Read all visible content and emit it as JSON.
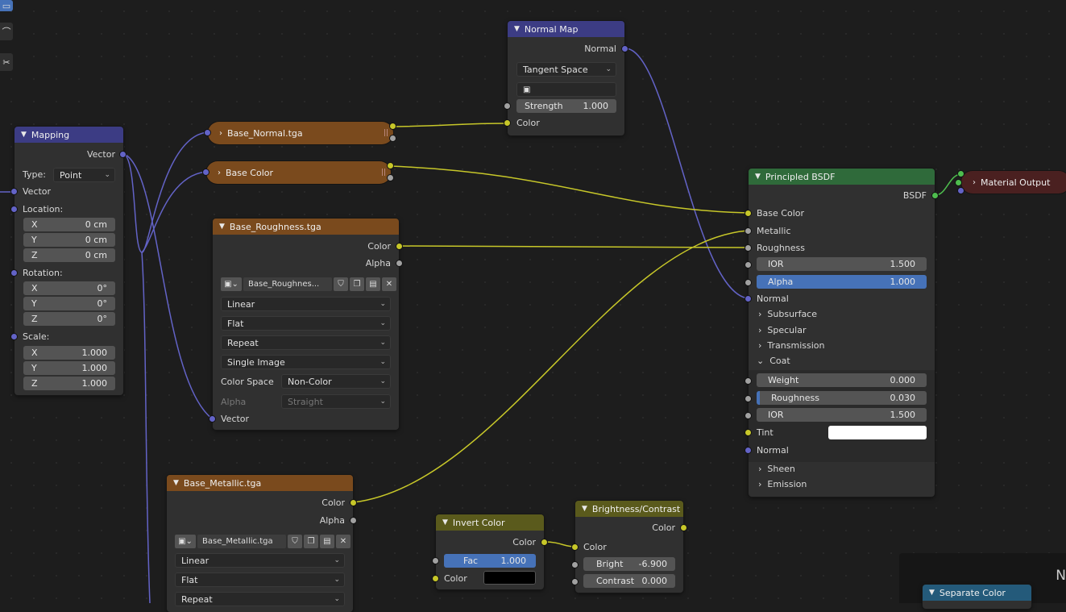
{
  "mapping": {
    "title": "Mapping",
    "out_vector": "Vector",
    "type_label": "Type:",
    "type_value": "Point",
    "in_vector": "Vector",
    "location": "Location:",
    "rotation": "Rotation:",
    "scale": "Scale:",
    "loc": [
      {
        "axis": "X",
        "value": "0 cm"
      },
      {
        "axis": "Y",
        "value": "0 cm"
      },
      {
        "axis": "Z",
        "value": "0 cm"
      }
    ],
    "rot": [
      {
        "axis": "X",
        "value": "0°"
      },
      {
        "axis": "Y",
        "value": "0°"
      },
      {
        "axis": "Z",
        "value": "0°"
      }
    ],
    "scl": [
      {
        "axis": "X",
        "value": "1.000"
      },
      {
        "axis": "Y",
        "value": "1.000"
      },
      {
        "axis": "Z",
        "value": "1.000"
      }
    ]
  },
  "base_normal": {
    "title": "Base_Normal.tga"
  },
  "base_color": {
    "title": "Base Color"
  },
  "normal_map": {
    "title": "Normal Map",
    "out_normal": "Normal",
    "space": "Tangent Space",
    "strength_label": "Strength",
    "strength_value": "1.000",
    "in_color": "Color"
  },
  "roughness": {
    "title": "Base_Roughness.tga",
    "out_color": "Color",
    "out_alpha": "Alpha",
    "image_name": "Base_Roughnes...",
    "interp": "Linear",
    "projection": "Flat",
    "extension": "Repeat",
    "source": "Single Image",
    "cs_label": "Color Space",
    "cs_value": "Non-Color",
    "alpha_label": "Alpha",
    "alpha_value": "Straight",
    "in_vector": "Vector"
  },
  "metallic": {
    "title": "Base_Metallic.tga",
    "out_color": "Color",
    "out_alpha": "Alpha",
    "image_name": "Base_Metallic.tga",
    "interp": "Linear",
    "projection": "Flat",
    "extension": "Repeat"
  },
  "invert": {
    "title": "Invert Color",
    "out_color": "Color",
    "fac_label": "Fac",
    "fac_value": "1.000",
    "in_color": "Color"
  },
  "bc": {
    "title": "Brightness/Contrast",
    "out_color": "Color",
    "in_color": "Color",
    "bright_label": "Bright",
    "bright_value": "-6.900",
    "contrast_label": "Contrast",
    "contrast_value": "0.000"
  },
  "bsdf": {
    "title": "Principled BSDF",
    "out": "BSDF",
    "base_color": "Base Color",
    "metallic": "Metallic",
    "roughness": "Roughness",
    "ior_label": "IOR",
    "ior_value": "1.500",
    "alpha_label": "Alpha",
    "alpha_value": "1.000",
    "normal": "Normal",
    "subsurface": "Subsurface",
    "specular": "Specular",
    "transmission": "Transmission",
    "coat": "Coat",
    "coat_weight_label": "Weight",
    "coat_weight_value": "0.000",
    "coat_rough_label": "Roughness",
    "coat_rough_value": "0.030",
    "coat_ior_label": "IOR",
    "coat_ior_value": "1.500",
    "tint": "Tint",
    "coat_normal": "Normal",
    "sheen": "Sheen",
    "emission": "Emission"
  },
  "material_output": {
    "title": "Material Output"
  },
  "separate": {
    "title": "Separate Color"
  },
  "corner_letter": "N",
  "colors": {
    "bg": "#1d1d1d",
    "node": "#303030",
    "input_hdr": "#3c3c84",
    "shader_hdr": "#2f6a3a",
    "texture_hdr": "#7a4a1d",
    "color_hdr": "#5a5a1c",
    "wire_vector": "#6363c7",
    "wire_color": "#c7c729",
    "wire_float": "#a1a1a1"
  }
}
